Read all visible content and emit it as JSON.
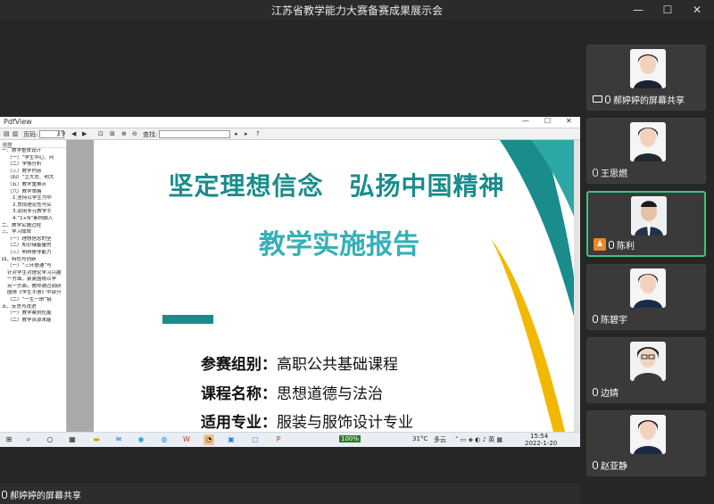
{
  "window": {
    "title": "江苏省教学能力大赛备赛成果展示会",
    "minimize_glyph": "—",
    "maximize_glyph": "☐",
    "close_glyph": "✕"
  },
  "pdfviewer": {
    "app_name": "PdfView",
    "page_label": "页码:",
    "page_value": "1",
    "page_total": "/ 9",
    "find_label": "查找:",
    "outline_header": "书签",
    "outline": [
      "一、教学整体设计",
      "（一）“学生中心、问",
      "（二）学情分析",
      "（三）教学内容",
      "（四）“立大志、明大",
      "（五）教学重难点",
      "（六）教学策略",
      "1.坚持以学生为中",
      "2.贯彻理论性与实",
      "3.运用多元教学手",
      "4.“1+N”素例融入",
      "二、教学实施过程",
      "三、学习成效",
      "（一）理想信念的坚",
      "（二）知识储备量的",
      "（三）明辨是非能力",
      "四、特色与创新",
      "（一）“三环联通”与",
      "针对学生对理论学习兴趣",
      "一方面，紧紧围绕以学",
      "另一方面，教师通过调研",
      "围绕《学生手册》中部分",
      "（二）“一生一册”链",
      "五、反思与改进",
      "（一）教学案例挖掘",
      "（二）教学资源未能"
    ]
  },
  "slide": {
    "title": "坚定理想信念　弘扬中国精神",
    "subtitle": "教学实施报告",
    "info": [
      {
        "label": "参赛组别：",
        "value": "高职公共基础课程"
      },
      {
        "label": "课程名称：",
        "value": "思想道德与法治"
      },
      {
        "label": "适用专业：",
        "value": "服装与服饰设计专业"
      }
    ],
    "colors": {
      "teal": "#1a8c8c",
      "light_teal": "#36b0b8",
      "yellow": "#f2b800"
    }
  },
  "taskbar": {
    "temperature": "31°C",
    "weather": "多云",
    "time": "15:54",
    "date": "2022-1-20",
    "badge": "100%"
  },
  "participants": [
    {
      "name": "郝婷婷的屏幕共享",
      "icon": "screen-share-icon",
      "active": false
    },
    {
      "name": "王思燃",
      "icon": "mic-muted-icon",
      "active": false
    },
    {
      "name": "陈利",
      "icon": "host-icon",
      "active": true
    },
    {
      "name": "陈碧宇",
      "icon": "mic-muted-icon",
      "active": false
    },
    {
      "name": "边婧",
      "icon": "mic-icon",
      "active": false
    },
    {
      "name": "赵亚静",
      "icon": "mic-icon",
      "active": false
    }
  ],
  "bottom_label": "郝婷婷的屏幕共享"
}
